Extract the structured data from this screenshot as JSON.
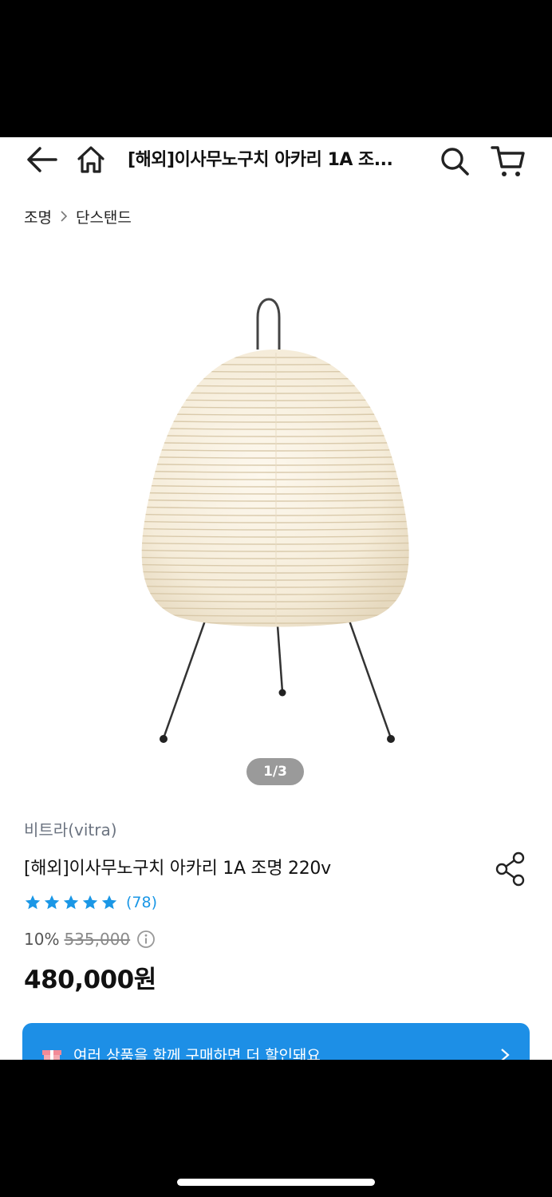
{
  "header": {
    "title": "[해외]이사무노구치 아카리 1A 조...",
    "icons": [
      "back-arrow-icon",
      "home-icon",
      "search-icon",
      "cart-icon"
    ]
  },
  "breadcrumb": {
    "items": [
      "조명",
      "단스탠드"
    ]
  },
  "gallery": {
    "pager": "1/3"
  },
  "product": {
    "brand": "비트라(vitra)",
    "name": "[해외]이사무노구치 아카리 1A 조명 220v",
    "rating_stars": 5,
    "review_count": "(78)",
    "discount": "10%",
    "original_price": "535,000",
    "price": "480,000원"
  },
  "promo": {
    "text": "여러 상품을 함께 구매하면 더 할인돼요"
  },
  "colors": {
    "accent": "#1d8fe6",
    "star": "#1a97e6",
    "lamp_paper": "#f7efdf"
  }
}
